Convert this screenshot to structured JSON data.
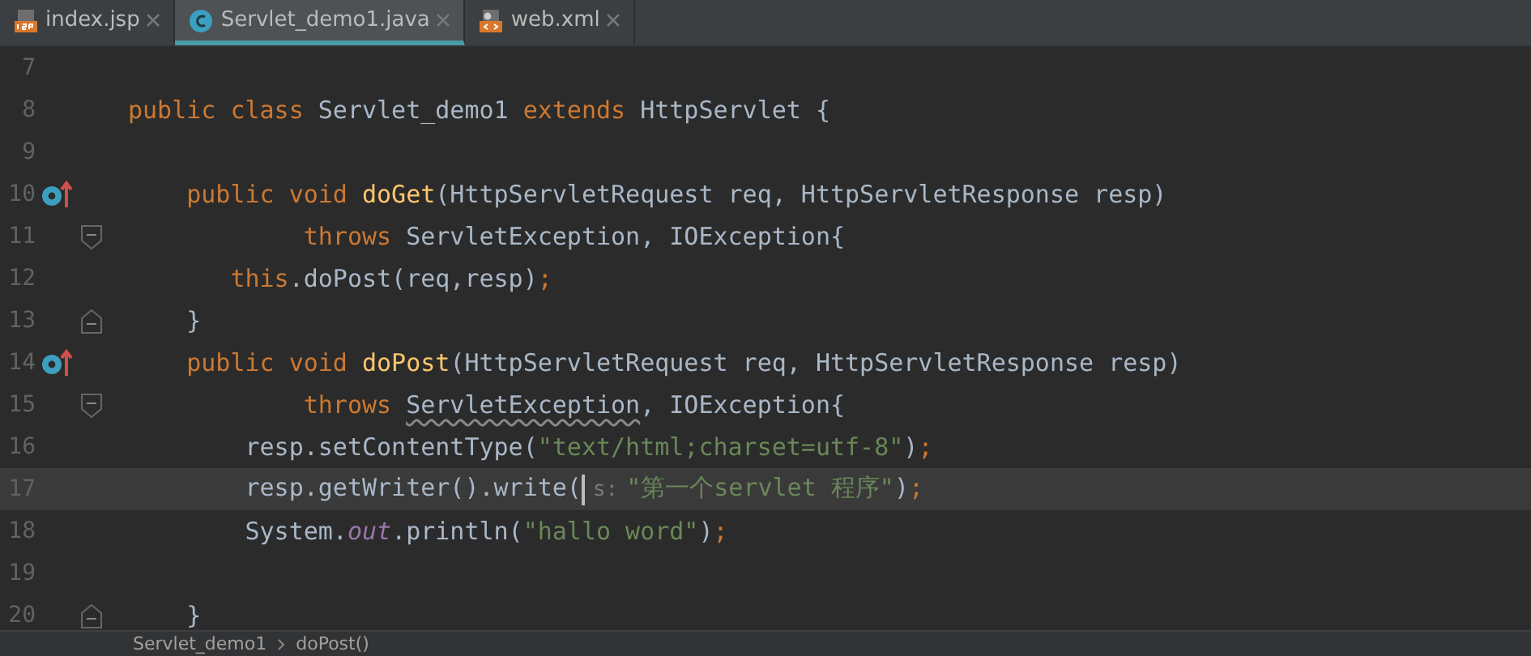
{
  "tabs": [
    {
      "label": "index.jsp",
      "kind": "jsp",
      "selected": false
    },
    {
      "label": "Servlet_demo1.java",
      "kind": "java",
      "selected": true
    },
    {
      "label": "web.xml",
      "kind": "xml",
      "selected": false
    }
  ],
  "lines": [
    {
      "number": "7",
      "current": false
    },
    {
      "number": "8",
      "current": false,
      "tokens": [
        {
          "kind": "keyword",
          "text": "public class "
        },
        {
          "kind": "text",
          "text": "Servlet_demo1 "
        },
        {
          "kind": "keyword",
          "text": "extends "
        },
        {
          "kind": "text",
          "text": "HttpServlet {"
        }
      ]
    },
    {
      "number": "9",
      "current": false
    },
    {
      "number": "10",
      "current": false,
      "gutter_icon": {
        "kind": "override"
      },
      "tokens": [
        {
          "kind": "keyword",
          "text": "    public void "
        },
        {
          "kind": "method",
          "text": "doGet"
        },
        {
          "kind": "text",
          "text": "(HttpServletRequest req, HttpServletResponse resp)"
        }
      ]
    },
    {
      "number": "11",
      "current": false,
      "fold": {
        "kind": "start"
      },
      "tokens": [
        {
          "kind": "keyword",
          "text": "            throws "
        },
        {
          "kind": "text",
          "text": "ServletException, IOException{"
        }
      ]
    },
    {
      "number": "12",
      "current": false,
      "tokens": [
        {
          "kind": "keyword",
          "text": "       this"
        },
        {
          "kind": "text",
          "text": ".doPost(req,resp)"
        },
        {
          "kind": "keyword",
          "text": ";"
        }
      ]
    },
    {
      "number": "13",
      "current": false,
      "fold": {
        "kind": "end"
      },
      "tokens": [
        {
          "kind": "text",
          "text": "    }"
        }
      ]
    },
    {
      "number": "14",
      "current": false,
      "gutter_icon": {
        "kind": "override"
      },
      "tokens": [
        {
          "kind": "keyword",
          "text": "    public void "
        },
        {
          "kind": "method",
          "text": "doPost"
        },
        {
          "kind": "text",
          "text": "(HttpServletRequest req, HttpServletResponse resp)"
        }
      ]
    },
    {
      "number": "15",
      "current": false,
      "fold": {
        "kind": "start"
      },
      "tokens": [
        {
          "kind": "keyword",
          "text": "            throws "
        },
        {
          "kind": "warn",
          "text": "ServletException"
        },
        {
          "kind": "text",
          "text": ", IOException{"
        }
      ]
    },
    {
      "number": "16",
      "current": false,
      "tokens": [
        {
          "kind": "text",
          "text": "        resp.setContentType("
        },
        {
          "kind": "string",
          "text": "\"text/html;charset=utf-8\""
        },
        {
          "kind": "text",
          "text": ")"
        },
        {
          "kind": "keyword",
          "text": ";"
        }
      ]
    },
    {
      "number": "17",
      "current": true,
      "tokens": [
        {
          "kind": "text",
          "text": "        resp.getWriter().write("
        },
        {
          "kind": "caret"
        },
        {
          "kind": "hint",
          "text": "s:"
        },
        {
          "kind": "string",
          "text": "\"第一个servlet 程序\""
        },
        {
          "kind": "text",
          "text": ")"
        },
        {
          "kind": "keyword",
          "text": ";"
        }
      ]
    },
    {
      "number": "18",
      "current": false,
      "tokens": [
        {
          "kind": "text",
          "text": "        System."
        },
        {
          "kind": "field",
          "text": "out"
        },
        {
          "kind": "text",
          "text": ".println("
        },
        {
          "kind": "string",
          "text": "\"hallo word\""
        },
        {
          "kind": "text",
          "text": ")"
        },
        {
          "kind": "keyword",
          "text": ";"
        }
      ]
    },
    {
      "number": "19",
      "current": false
    },
    {
      "number": "20",
      "current": false,
      "fold": {
        "kind": "end"
      },
      "tokens": [
        {
          "kind": "text",
          "text": "    }"
        }
      ]
    }
  ],
  "breadcrumbs": [
    "Servlet_demo1",
    "doPost()"
  ]
}
